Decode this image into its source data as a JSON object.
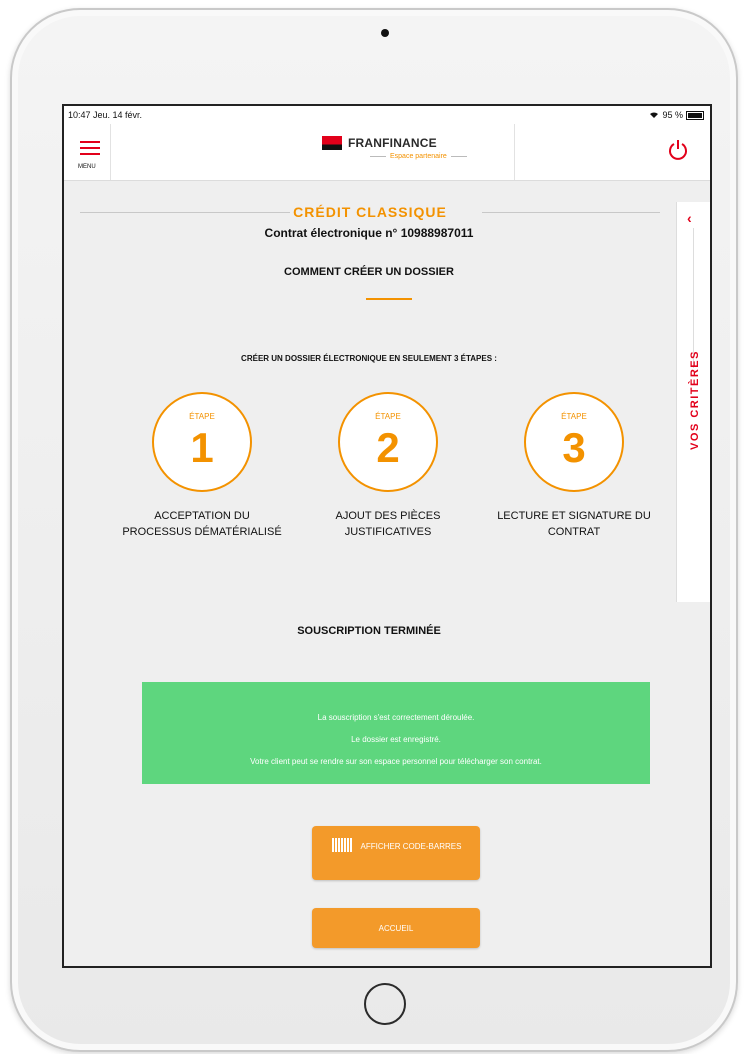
{
  "status": {
    "time": "10:47  Jeu. 14 févr.",
    "battery": "95 %"
  },
  "nav": {
    "menu_label": "MENU",
    "brand": "FRANFINANCE",
    "brand_sub": "Espace partenaire"
  },
  "side_tab": {
    "label": "VOS CRITÈRES",
    "chevron": "‹"
  },
  "header": {
    "product": "CRÉDIT CLASSIQUE",
    "contract": "Contrat électronique n° 10988987011"
  },
  "how_to": {
    "title": "COMMENT CRÉER UN DOSSIER",
    "intro": "CRÉER UN DOSSIER ÉLECTRONIQUE EN SEULEMENT 3 ÉTAPES :"
  },
  "steps": [
    {
      "label": "ÉTAPE",
      "number": "1",
      "text": "ACCEPTATION DU PROCESSUS DÉMATÉRIALISÉ"
    },
    {
      "label": "ÉTAPE",
      "number": "2",
      "text": "AJOUT DES PIÈCES JUSTIFICATIVES"
    },
    {
      "label": "ÉTAPE",
      "number": "3",
      "text": "LECTURE ET SIGNATURE DU CONTRAT"
    }
  ],
  "done": {
    "title": "SOUSCRIPTION TERMINÉE",
    "line1": "La souscription s'est correctement déroulée.",
    "line2": "Le dossier est enregistré.",
    "line3": "Votre client peut se rendre sur son espace personnel pour télécharger son contrat."
  },
  "buttons": {
    "barcode": "AFFICHER CODE-BARRES",
    "home": "ACCUEIL"
  },
  "colors": {
    "accent": "#f39200",
    "brand_red": "#e2001a",
    "success": "#5ed67e"
  },
  "icons": {
    "menu": "hamburger-icon",
    "power": "power-icon",
    "barcode": "barcode-icon",
    "wifi": "wifi-icon",
    "battery": "battery-icon"
  }
}
